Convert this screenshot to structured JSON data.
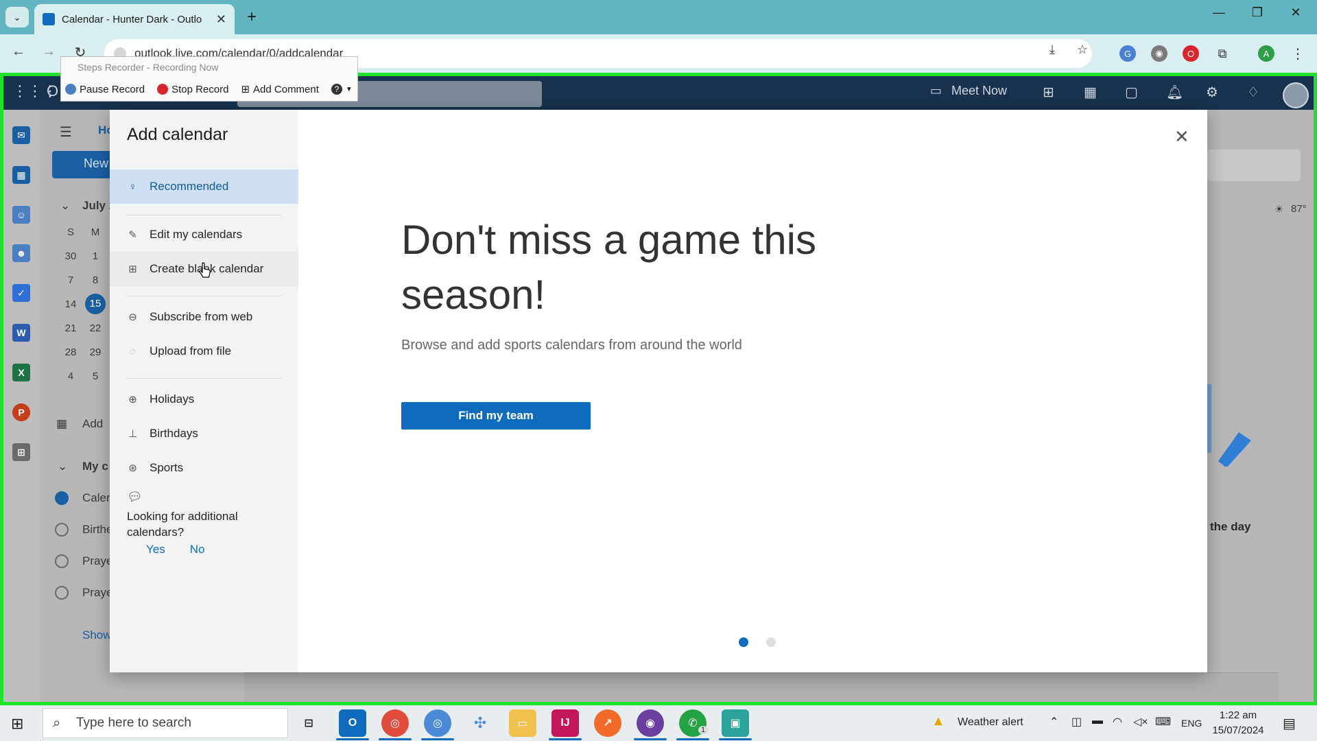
{
  "browser": {
    "tab_title": "Calendar - Hunter Dark - Outlo",
    "url": "outlook.live.com/calendar/0/addcalendar",
    "profile_initial": "A",
    "notification_count": "1"
  },
  "steps_recorder": {
    "title": "Steps Recorder - Recording Now",
    "pause_label": "Pause Record",
    "stop_label": "Stop Record",
    "comment_label": "Add Comment",
    "help_label": "?"
  },
  "outlook_header": {
    "brand": "O",
    "meet_now": "Meet Now"
  },
  "background": {
    "home_tab": "Ho",
    "new_button": "New",
    "month": "July 2",
    "weekdays": [
      "S",
      "M"
    ],
    "weeks": [
      [
        "30",
        "1"
      ],
      [
        "7",
        "8"
      ],
      [
        "14",
        "15"
      ],
      [
        "21",
        "22"
      ],
      [
        "28",
        "29"
      ],
      [
        "4",
        "5"
      ]
    ],
    "add_calendar": "Add",
    "my_calendars": "My c",
    "calendars": [
      "Caler",
      "Birthe",
      "Praye",
      "Praye"
    ],
    "show_more": "Show",
    "weather": "87°",
    "the_day": "the day"
  },
  "modal": {
    "title": "Add calendar",
    "nav": [
      {
        "label": "Recommended",
        "icon": "lightbulb-icon"
      },
      {
        "label": "Edit my calendars",
        "icon": "calendar-edit-icon"
      },
      {
        "label": "Create blank calendar",
        "icon": "calendar-add-icon"
      },
      {
        "label": "Subscribe from web",
        "icon": "link-icon"
      },
      {
        "label": "Upload from file",
        "icon": "upload-icon"
      },
      {
        "label": "Holidays",
        "icon": "globe-icon"
      },
      {
        "label": "Birthdays",
        "icon": "cake-icon"
      },
      {
        "label": "Sports",
        "icon": "ball-icon"
      }
    ],
    "feedback_question": "Looking for additional calendars?",
    "feedback_yes": "Yes",
    "feedback_no": "No",
    "hero_title": "Don't miss a game this season!",
    "hero_subtitle": "Browse and add sports calendars from around the world",
    "cta": "Find my team"
  },
  "taskbar": {
    "search_placeholder": "Type here to search",
    "weather_alert": "Weather alert",
    "language": "ENG",
    "time": "1:22 am",
    "date": "15/07/2024",
    "whatsapp_badge": "1"
  },
  "colors": {
    "accent": "#0f6cbd",
    "frame": "#1ee32a",
    "selected_nav_bg": "#cfe0f4"
  }
}
